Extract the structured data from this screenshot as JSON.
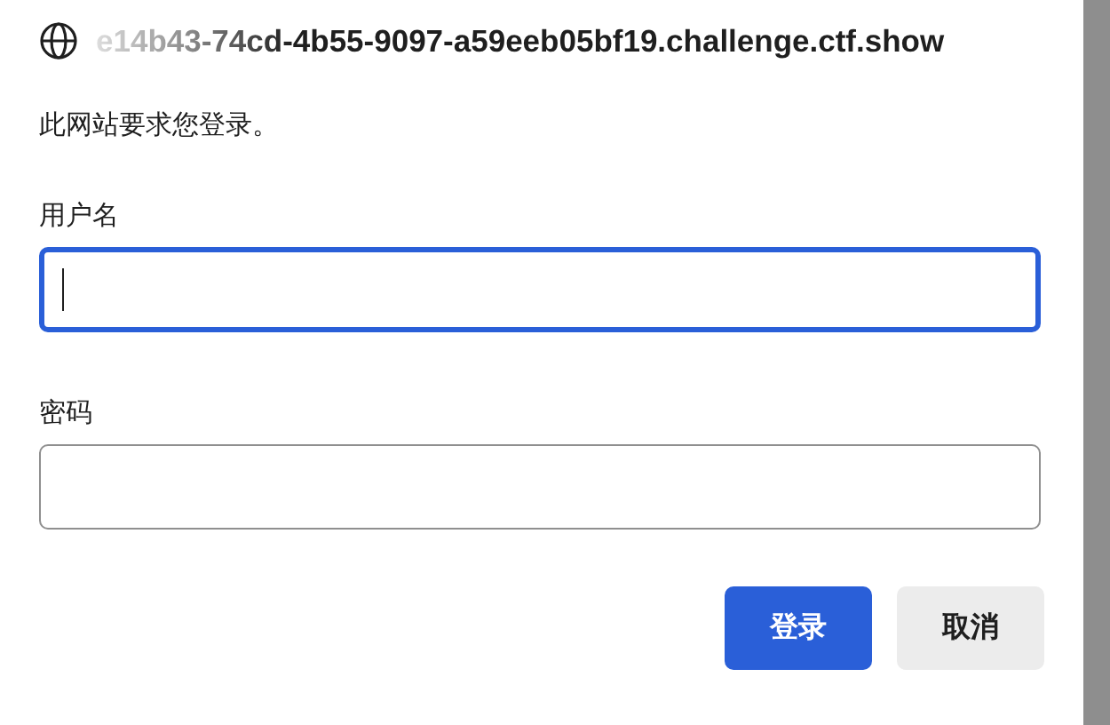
{
  "dialog": {
    "site": "e14b43-74cd-4b55-9097-a59eeb05bf19.challenge.ctf.show",
    "message": "此网站要求您登录。",
    "fields": [
      {
        "label": "用户名",
        "focused": true
      },
      {
        "label": "密码",
        "focused": false
      }
    ],
    "buttons": [
      {
        "label": "登录",
        "kind": "primary"
      },
      {
        "label": "取消",
        "kind": "secondary"
      }
    ]
  }
}
